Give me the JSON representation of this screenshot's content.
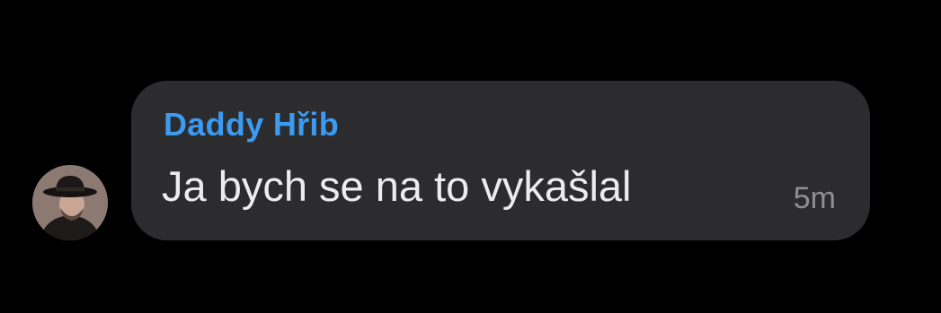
{
  "message": {
    "sender": "Daddy Hřib",
    "text": "Ja bych se na to vykašlal",
    "time": "5m",
    "avatar_icon": "profile-photo-man-with-hat"
  },
  "colors": {
    "background": "#000000",
    "bubble": "#2c2c2e",
    "sender_name": "#3a9bf0",
    "message_text": "#ebebf0",
    "timestamp": "#8e8e93"
  }
}
